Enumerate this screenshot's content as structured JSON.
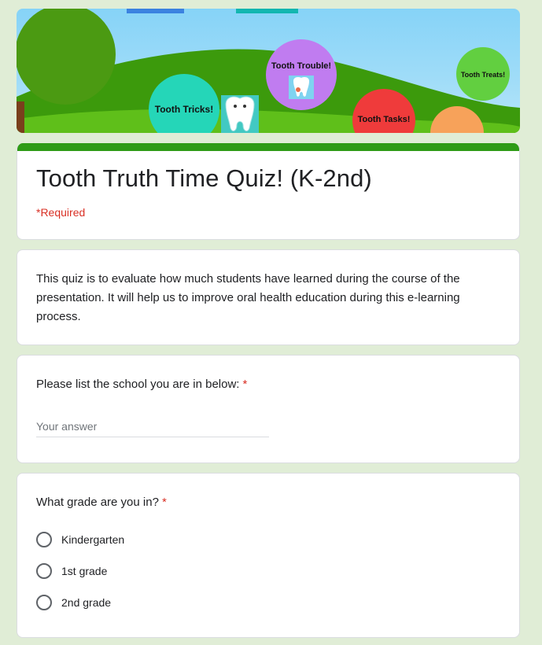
{
  "banner": {
    "bubbles": {
      "tricks": "Tooth Tricks!",
      "trouble": "Tooth Trouble!",
      "tasks": "Tooth Tasks!",
      "treats": "Tooth Treats!"
    },
    "colors": {
      "sky": "#86d3f7",
      "hill_dark": "#3c9a0c",
      "hill_light": "#5fbf1a",
      "tricks": "#25d6b8",
      "trouble": "#c07cf0",
      "tasks": "#ef3b3b",
      "treats": "#62cf40",
      "orange": "#f7a25a"
    }
  },
  "form": {
    "title": "Tooth Truth Time Quiz! (K-2nd)",
    "required_note": "*Required",
    "accent_color": "#2e9b16",
    "description": "This quiz is to evaluate how much students have learned during the course of the presentation. It will help us to improve oral health education during this e-learning process."
  },
  "questions": [
    {
      "label": "Please list the school you are in below:",
      "required_mark": "*",
      "placeholder": "Your answer",
      "value": ""
    },
    {
      "label": "What grade are you in?",
      "required_mark": "*",
      "options": [
        "Kindergarten",
        "1st grade",
        "2nd grade"
      ]
    }
  ]
}
